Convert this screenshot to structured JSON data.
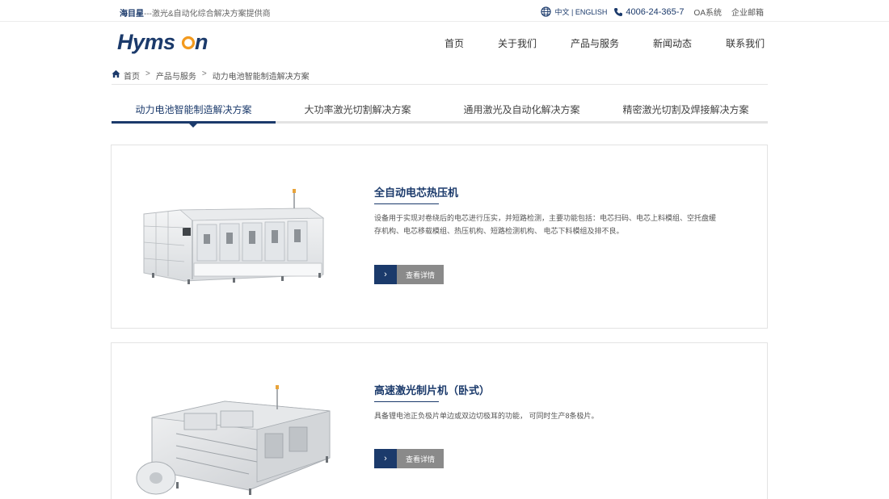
{
  "topbar": {
    "brand": "海目星",
    "slogan": "---激光&自动化综合解决方案提供商",
    "lang": "中文 | ENGLISH",
    "phone": "4006-24-365-7",
    "oa": "OA系统",
    "mail": "企业邮箱"
  },
  "header": {
    "logo_text": "Hymson",
    "nav": [
      "首页",
      "关于我们",
      "产品与服务",
      "新闻动态",
      "联系我们"
    ]
  },
  "breadcrumb": {
    "home": "首页",
    "sep": ">",
    "level2": "产品与服务",
    "level3": "动力电池智能制造解决方案"
  },
  "tabs": [
    "动力电池智能制造解决方案",
    "大功率激光切割解决方案",
    "通用激光及自动化解决方案",
    "精密激光切割及焊接解决方案"
  ],
  "products": [
    {
      "title": "全自动电芯热压机",
      "desc": "设备用于实现对卷绕后的电芯进行压实，并短路检测，主要功能包括：电芯扫码、电芯上料模组、空托盘缓存机构、电芯移载模组、热压机构、短路检测机构、 电芯下料模组及排不良。",
      "more": "查看详情"
    },
    {
      "title": "高速激光制片机（卧式）",
      "desc": "具备锂电池正负极片单边或双边切极耳的功能， 可同时生产8条极片。",
      "more": "查看详情"
    }
  ],
  "colors": {
    "brand": "#1b3a6b",
    "button_gray": "#8a8a8a",
    "logo_orange": "#f39a1e"
  }
}
